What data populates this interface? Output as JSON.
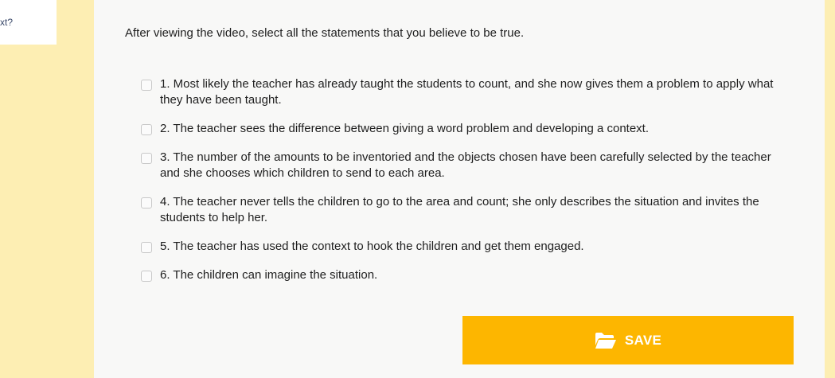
{
  "sidebar_card": {
    "partial_text": "xt?"
  },
  "question": {
    "instruction": "After viewing the video, select all the statements that you believe to be true.",
    "options": [
      {
        "label": "1. Most likely the teacher has already taught the students to count, and she now gives them a problem to apply what they have been taught.",
        "checked": false
      },
      {
        "label": "2. The teacher sees the difference between giving a word problem and developing a context.",
        "checked": false
      },
      {
        "label": "3. The number of the amounts to be inventoried and the objects chosen have been carefully selected by the teacher and she chooses which children to send to each area.",
        "checked": false
      },
      {
        "label": "4. The teacher never tells the children to go to the area and count; she only describes the situation and invites the students to help her.",
        "checked": false
      },
      {
        "label": "5. The teacher has used the context to hook the children and get them engaged.",
        "checked": false
      },
      {
        "label": "6. The children can imagine the situation.",
        "checked": false
      }
    ]
  },
  "save_button": {
    "label": "SAVE",
    "icon": "folder-open-icon"
  },
  "colors": {
    "background": "#fdeeb8",
    "panel": "#f8f8f7",
    "accent": "#fdb600",
    "text": "#1e1e1e"
  }
}
